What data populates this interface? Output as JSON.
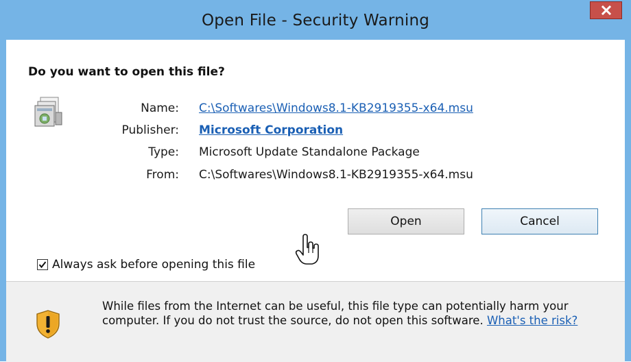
{
  "window": {
    "title": "Open File - Security Warning",
    "close_glyph": "x",
    "frame_color": "#75b4e6",
    "close_color": "#c7504a"
  },
  "dialog": {
    "question": "Do you want to open this file?",
    "file_icon": "msu-package-icon",
    "fields": [
      {
        "label": "Name:",
        "value": "C:\\Softwares\\Windows8.1-KB2919355-x64.msu",
        "style": "link"
      },
      {
        "label": "Publisher:",
        "value": "Microsoft Corporation",
        "style": "link-bold"
      },
      {
        "label": "Type:",
        "value": "Microsoft Update Standalone Package",
        "style": "plain"
      },
      {
        "label": "From:",
        "value": "C:\\Softwares\\Windows8.1-KB2919355-x64.msu",
        "style": "plain"
      }
    ],
    "buttons": {
      "open": "Open",
      "cancel": "Cancel"
    },
    "always_ask": {
      "label": "Always ask before opening this file",
      "checked": true
    }
  },
  "warning": {
    "icon": "shield-warning-icon",
    "text": "While files from the Internet can be useful, this file type can potentially harm your computer. If you do not trust the source, do not open this software.",
    "link": "What's the risk?",
    "link_color": "#1a5fb4"
  },
  "cursor": "hand-pointer-icon"
}
